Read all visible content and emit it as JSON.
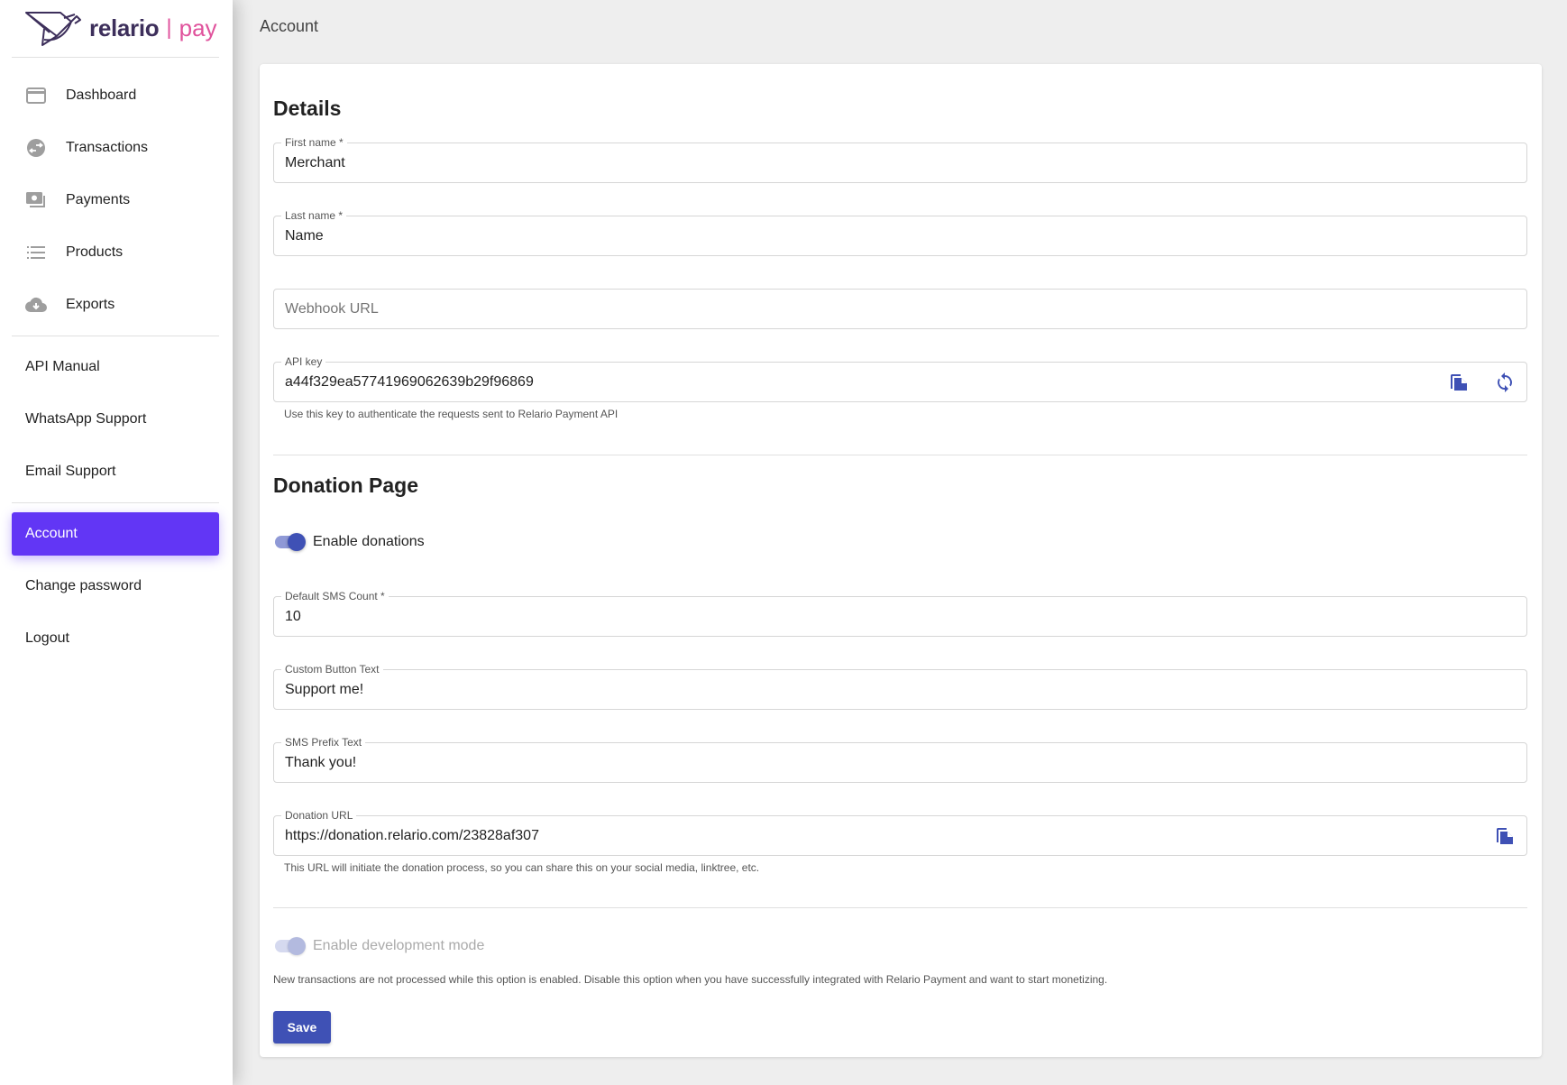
{
  "brand": {
    "name": "relario",
    "separator": "|",
    "product": "pay"
  },
  "colors": {
    "accent": "#6236f5",
    "primary": "#3f51b5",
    "brand_dark": "#3d2f5b",
    "brand_pink": "#e0529c"
  },
  "sidebar": {
    "items": [
      {
        "label": "Dashboard",
        "icon": "credit-card-icon"
      },
      {
        "label": "Transactions",
        "icon": "swap-circle-icon"
      },
      {
        "label": "Payments",
        "icon": "payments-icon"
      },
      {
        "label": "Products",
        "icon": "list-icon"
      },
      {
        "label": "Exports",
        "icon": "cloud-download-icon"
      }
    ],
    "links": [
      {
        "label": "API Manual"
      },
      {
        "label": "WhatsApp Support"
      },
      {
        "label": "Email Support"
      }
    ],
    "account": [
      {
        "label": "Account",
        "active": true
      },
      {
        "label": "Change password"
      },
      {
        "label": "Logout"
      }
    ]
  },
  "page": {
    "title": "Account"
  },
  "details": {
    "title": "Details",
    "first_name": {
      "label": "First name *",
      "value": "Merchant"
    },
    "last_name": {
      "label": "Last name *",
      "value": "Name"
    },
    "webhook": {
      "placeholder": "Webhook URL",
      "value": ""
    },
    "api_key": {
      "label": "API key",
      "value": "a44f329ea57741969062639b29f96869",
      "helper": "Use this key to authenticate the requests sent to Relario Payment API"
    }
  },
  "donation": {
    "title": "Donation Page",
    "enable_label": "Enable donations",
    "enabled": true,
    "sms_count": {
      "label": "Default SMS Count *",
      "value": "10"
    },
    "button_text": {
      "label": "Custom Button Text",
      "value": "Support me!"
    },
    "sms_prefix": {
      "label": "SMS Prefix Text",
      "value": "Thank you!"
    },
    "url": {
      "label": "Donation URL",
      "value": "https://donation.relario.com/23828af307",
      "helper": "This URL will initiate the donation process, so you can share this on your social media, linktree, etc."
    }
  },
  "dev_mode": {
    "label": "Enable development mode",
    "enabled": true,
    "disabled": true,
    "note": "New transactions are not processed while this option is enabled. Disable this option when you have successfully integrated with Relario Payment and want to start monetizing."
  },
  "actions": {
    "save_label": "Save"
  }
}
